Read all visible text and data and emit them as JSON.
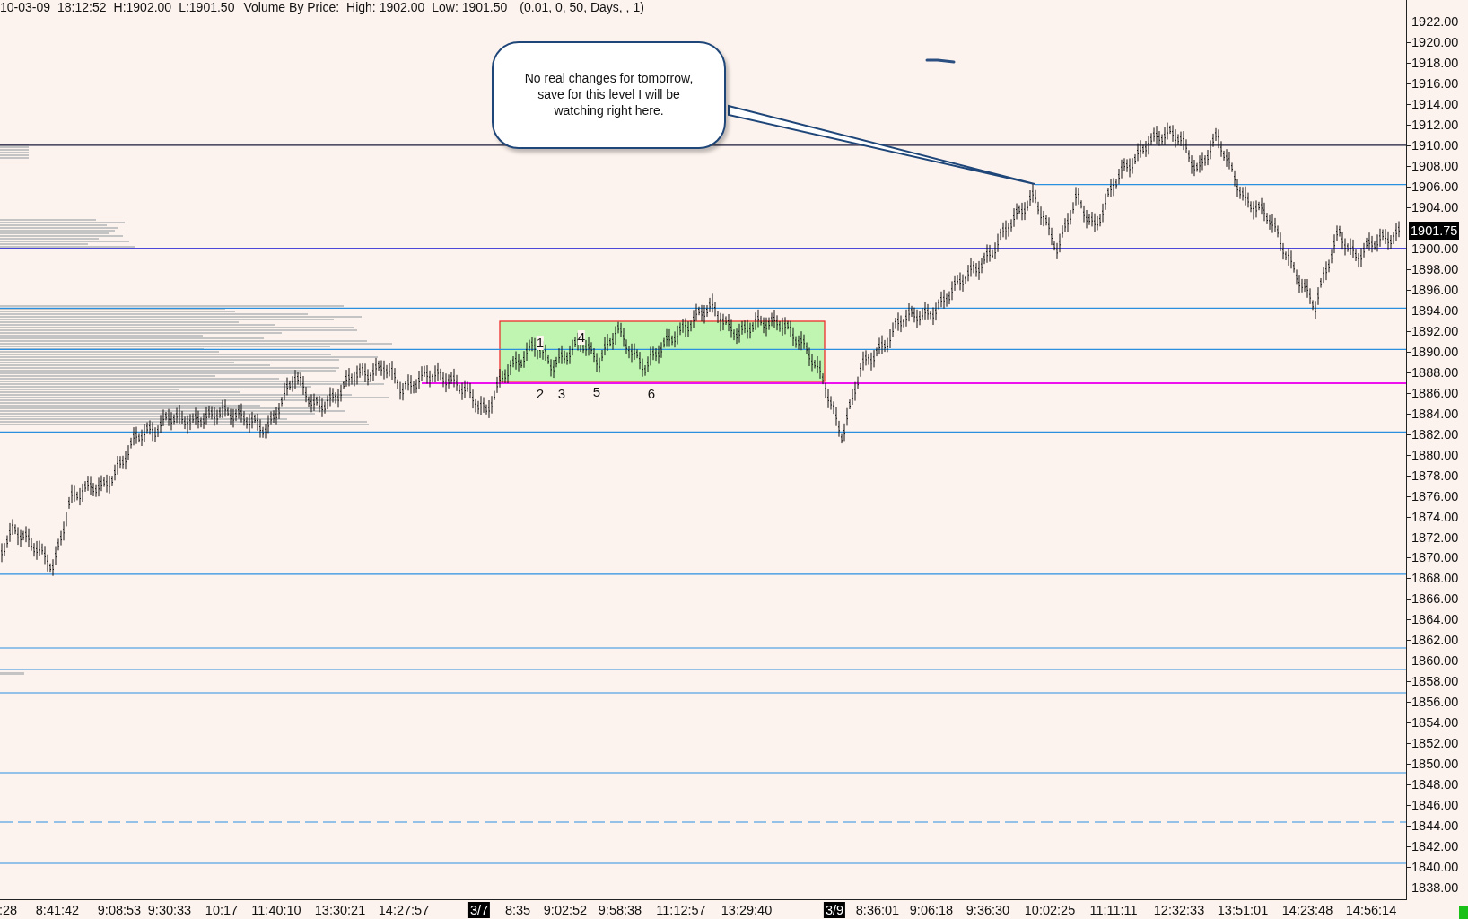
{
  "header": {
    "items": [
      "10-03-09",
      "18:12:52",
      "H:1902.00",
      "L:1901.50",
      "Volume By Price:",
      "High: 1902.00",
      "Low: 1901.50",
      "(0.01, 0, 50, Days, , 1)"
    ]
  },
  "annotation": {
    "text": "No real changes for tomorrow, save for this level I will be watching right here."
  },
  "markers": [
    "1",
    "4",
    "2",
    "3",
    "5",
    "6"
  ],
  "price_axis": {
    "labels": [
      "1922.00",
      "1920.00",
      "1918.00",
      "1916.00",
      "1914.00",
      "1912.00",
      "1910.00",
      "1908.00",
      "1906.00",
      "1904.00",
      "1900.00",
      "1898.00",
      "1896.00",
      "1894.00",
      "1892.00",
      "1890.00",
      "1888.00",
      "1886.00",
      "1884.00",
      "1882.00",
      "1880.00",
      "1878.00",
      "1876.00",
      "1874.00",
      "1872.00",
      "1870.00",
      "1868.00",
      "1866.00",
      "1864.00",
      "1862.00",
      "1860.00",
      "1858.00",
      "1856.00",
      "1854.00",
      "1852.00",
      "1850.00",
      "1848.00",
      "1846.00",
      "1844.00",
      "1842.00",
      "1840.00",
      "1838.00"
    ],
    "last_price": "1901.75"
  },
  "time_axis": {
    "labels": [
      {
        "text": ":28",
        "kind": "time"
      },
      {
        "text": "8:41:42",
        "kind": "time"
      },
      {
        "text": "9:08:53",
        "kind": "time"
      },
      {
        "text": "9:30:33",
        "kind": "time"
      },
      {
        "text": "10:17",
        "kind": "time"
      },
      {
        "text": "11:40:10",
        "kind": "time"
      },
      {
        "text": "13:30:21",
        "kind": "time"
      },
      {
        "text": "14:27:57",
        "kind": "time"
      },
      {
        "text": "3/7",
        "kind": "date"
      },
      {
        "text": "8:35",
        "kind": "time"
      },
      {
        "text": "9:02:52",
        "kind": "time"
      },
      {
        "text": "9:58:38",
        "kind": "time"
      },
      {
        "text": "11:12:57",
        "kind": "time"
      },
      {
        "text": "13:29:40",
        "kind": "time"
      },
      {
        "text": "3/9",
        "kind": "date"
      },
      {
        "text": "8:36:01",
        "kind": "time"
      },
      {
        "text": "9:06:18",
        "kind": "time"
      },
      {
        "text": "9:36:30",
        "kind": "time"
      },
      {
        "text": "10:02:25",
        "kind": "time"
      },
      {
        "text": "11:11:11",
        "kind": "time"
      },
      {
        "text": "12:32:33",
        "kind": "time"
      },
      {
        "text": "13:51:01",
        "kind": "time"
      },
      {
        "text": "14:23:48",
        "kind": "time"
      },
      {
        "text": "14:56:14",
        "kind": "time"
      }
    ]
  }
}
